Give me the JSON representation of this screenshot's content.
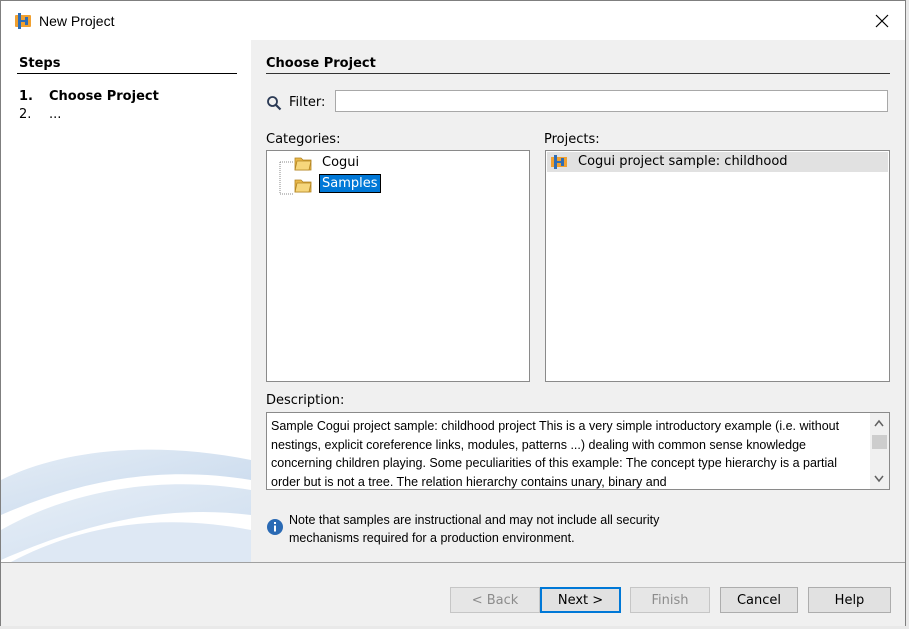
{
  "window": {
    "title": "New Project",
    "close_icon": "close-icon"
  },
  "steps": {
    "title": "Steps",
    "items": [
      {
        "num": "1.",
        "label": "Choose Project"
      },
      {
        "num": "2.",
        "label": "..."
      }
    ]
  },
  "main": {
    "section_title": "Choose Project",
    "filter": {
      "label": "Filter:",
      "value": "",
      "icon": "search-icon"
    },
    "categories": {
      "label": "Categories:",
      "items": [
        {
          "label": "Cogui",
          "icon": "folder-icon",
          "selected": false
        },
        {
          "label": "Samples",
          "icon": "folder-icon",
          "selected": true
        }
      ]
    },
    "projects": {
      "label": "Projects:",
      "items": [
        {
          "label": "Cogui project sample: childhood",
          "icon": "project-icon",
          "selected": true
        }
      ]
    },
    "description": {
      "label": "Description:",
      "text": "Sample Cogui project sample: childhood project This is a very simple introductory example (i.e. without nestings, explicit coreference links, modules, patterns ...) dealing with common sense knowledge concerning children playing. Some peculiarities of this example: The concept type hierarchy is a partial order but is not a tree. The relation hierarchy contains unary, binary and"
    },
    "note": {
      "icon": "info-icon",
      "text": "Note that samples are instructional and may not include all security mechanisms required for a production environment."
    }
  },
  "buttons": {
    "back": "< Back",
    "next": "Next >",
    "finish": "Finish",
    "cancel": "Cancel",
    "help": "Help"
  },
  "colors": {
    "selection": "#0078d7",
    "panel_bg": "#f0f0f0",
    "accent_orange": "#f0a030"
  }
}
